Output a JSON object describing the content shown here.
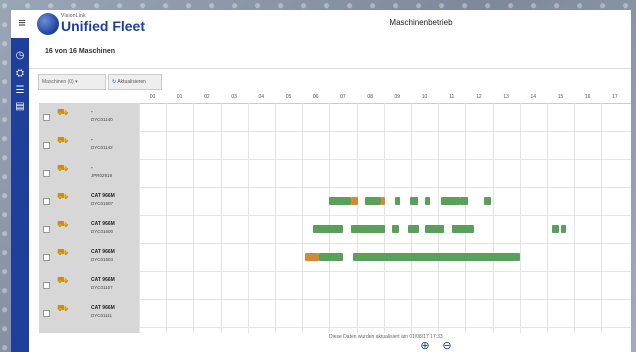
{
  "header": {
    "brand_small": "VisionLink",
    "brand": "Unified Fleet",
    "title": "Maschinenbetrieb",
    "menu_icon": "hamburger-icon"
  },
  "sidebar": {
    "icons": [
      "dashboard-icon",
      "machines-icon",
      "list-icon",
      "report-icon"
    ]
  },
  "subheader": {
    "count_text": "16 von 16 Maschinen"
  },
  "toolbar": {
    "filter_label": "Maschinen (0) ▾",
    "refresh_label": "Aktualisieren",
    "refresh_icon": "refresh-icon"
  },
  "timeline": {
    "hours": [
      "00",
      "01",
      "02",
      "03",
      "04",
      "05",
      "06",
      "07",
      "08",
      "09",
      "10",
      "11",
      "12",
      "13",
      "14",
      "15",
      "16",
      "17"
    ]
  },
  "machines": [
    {
      "name": "-",
      "id": "DYC01140"
    },
    {
      "name": "-",
      "id": "DYC01142"
    },
    {
      "name": "-",
      "id": "JPR02919"
    },
    {
      "name": "CAT 966M",
      "id": "DYC01607"
    },
    {
      "name": "CAT 966M",
      "id": "DYC01600"
    },
    {
      "name": "CAT 966M",
      "id": "DYC01603"
    },
    {
      "name": "CAT 966M",
      "id": "DYC01107"
    },
    {
      "name": "CAT 966M",
      "id": "DYC01111"
    }
  ],
  "activity": [
    {
      "row": 3,
      "segments": [
        [
          7.0,
          7.8,
          "#5c9e5c"
        ],
        [
          7.8,
          8.05,
          "#d08a3a"
        ],
        [
          8.3,
          8.9,
          "#5c9e5c"
        ],
        [
          8.9,
          9.05,
          "#d08a3a"
        ],
        [
          9.4,
          9.6,
          "#5c9e5c"
        ],
        [
          9.95,
          10.25,
          "#5c9e5c"
        ],
        [
          10.5,
          10.7,
          "#5c9e5c"
        ],
        [
          11.1,
          11.8,
          "#5c9e5c"
        ],
        [
          11.8,
          12.1,
          "#5c9e5c"
        ],
        [
          12.7,
          12.95,
          "#5c9e5c"
        ]
      ]
    },
    {
      "row": 4,
      "segments": [
        [
          6.4,
          7.5,
          "#5c9e5c"
        ],
        [
          7.8,
          9.05,
          "#5c9e5c"
        ],
        [
          9.3,
          9.55,
          "#5c9e5c"
        ],
        [
          9.9,
          10.3,
          "#5c9e5c"
        ],
        [
          10.5,
          11.2,
          "#5c9e5c"
        ],
        [
          11.5,
          12.3,
          "#5c9e5c"
        ],
        [
          15.2,
          15.45,
          "#5c9e5c"
        ],
        [
          15.5,
          15.7,
          "#5c9e5c"
        ]
      ]
    },
    {
      "row": 5,
      "segments": [
        [
          6.1,
          6.6,
          "#d08a3a"
        ],
        [
          6.6,
          7.5,
          "#5c9e5c"
        ],
        [
          7.85,
          14.0,
          "#5c9e5c"
        ]
      ]
    }
  ],
  "colors": {
    "brand": "#1d3f9a",
    "sidebar": "#1e3f9a",
    "active": "#5c9e5c",
    "idle": "#d08a3a",
    "machine_col": "#d7d7d7"
  },
  "footer": {
    "updated_text": "Diese Daten wurden aktualisiert am 01/08/17 17:33",
    "zoom_in_icon": "zoom-in-icon",
    "zoom_out_icon": "zoom-out-icon"
  }
}
